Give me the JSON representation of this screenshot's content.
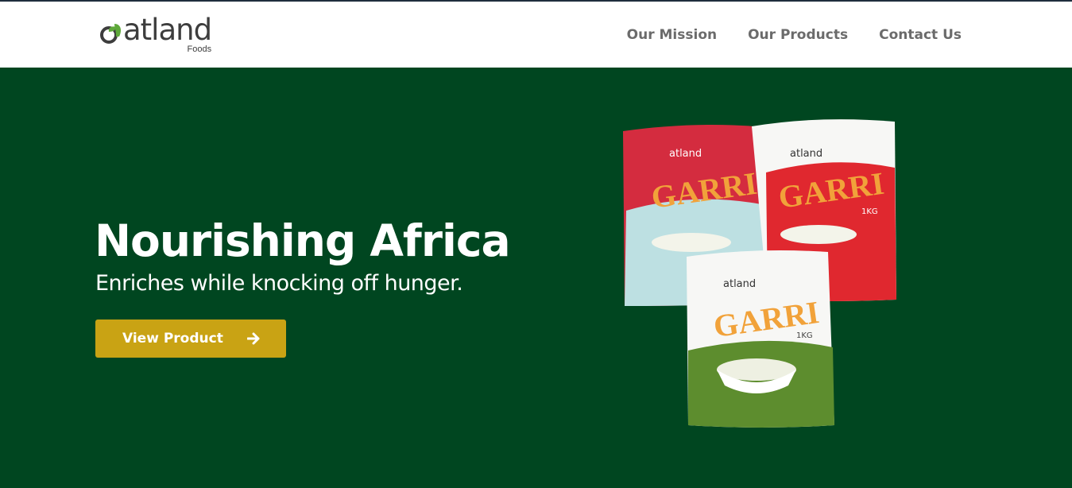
{
  "brand": {
    "name": "atland",
    "sub": "Foods"
  },
  "nav": {
    "items": [
      "Our Mission",
      "Our Products",
      "Contact Us"
    ]
  },
  "hero": {
    "title": "Nourishing Africa",
    "subtitle": "Enriches while knocking off hunger.",
    "cta_label": "View Product"
  },
  "products": {
    "brand": "atland",
    "name": "GARRI",
    "weight": "1KG",
    "packs": [
      "red",
      "white",
      "green"
    ]
  },
  "colors": {
    "hero_bg": "#004620",
    "cta": "#c9a314",
    "nav_text": "#6b6b6b",
    "leaf": "#5ea83a"
  }
}
